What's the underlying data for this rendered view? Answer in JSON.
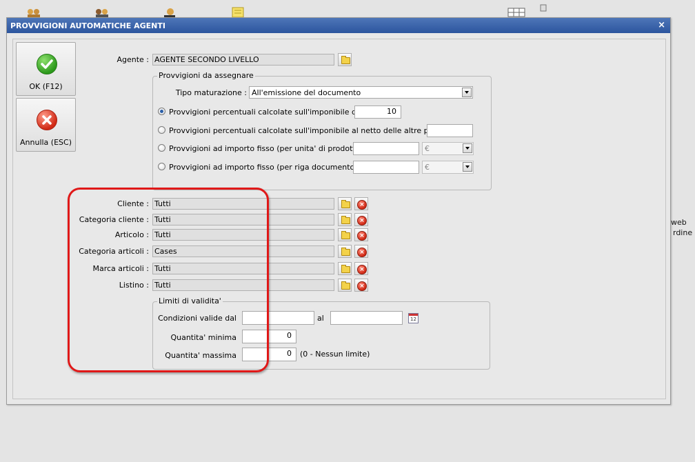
{
  "dialog": {
    "title": "PROVVIGIONI AUTOMATICHE AGENTI",
    "close_glyph": "×"
  },
  "buttons": {
    "ok_label": "OK (F12)",
    "cancel_label": "Annulla (ESC)"
  },
  "agent": {
    "label": "Agente :",
    "value": "AGENTE SECONDO LIVELLO"
  },
  "commissions": {
    "group_title": "Provvigioni da assegnare",
    "accrual_label": "Tipo maturazione :",
    "accrual_value": "All'emissione del documento",
    "options": [
      {
        "label": "Provvigioni percentuali calcolate sull'imponibile di riga",
        "value": "10",
        "selected": true
      },
      {
        "label": "Provvigioni percentuali calcolate sull'imponibile al netto delle altre provvigioni",
        "value": "",
        "selected": false
      },
      {
        "label": "Provvigioni ad importo fisso (per unita' di prodotto)",
        "value": "",
        "currency": "€",
        "selected": false
      },
      {
        "label": "Provvigioni ad importo fisso (per riga documento)",
        "value": "",
        "currency": "€",
        "selected": false
      }
    ]
  },
  "filters": [
    {
      "label": "Cliente :",
      "value": "Tutti"
    },
    {
      "label": "Categoria cliente :",
      "value": "Tutti"
    },
    {
      "label": "Articolo :",
      "value": "Tutti"
    },
    {
      "label": "Categoria articoli :",
      "value": "Cases"
    },
    {
      "label": "Marca articoli :",
      "value": "Tutti"
    },
    {
      "label": "Listino :",
      "value": "Tutti"
    }
  ],
  "validity": {
    "group_title": "Limiti di validita'",
    "valid_from_label": "Condizioni valide dal",
    "valid_from_value": "",
    "valid_to_label": "al",
    "valid_to_value": "",
    "calendar_day": "12",
    "min_qty_label": "Quantita' minima",
    "min_qty_value": "0",
    "max_qty_label": "Quantita' massima",
    "max_qty_value": "0",
    "max_qty_note": "(0 - Nessun limite)"
  },
  "background": {
    "fragment_1": "web",
    "fragment_2": "rdine"
  },
  "colors": {
    "title_bar": "#2c559e",
    "highlight": "#e01818"
  }
}
